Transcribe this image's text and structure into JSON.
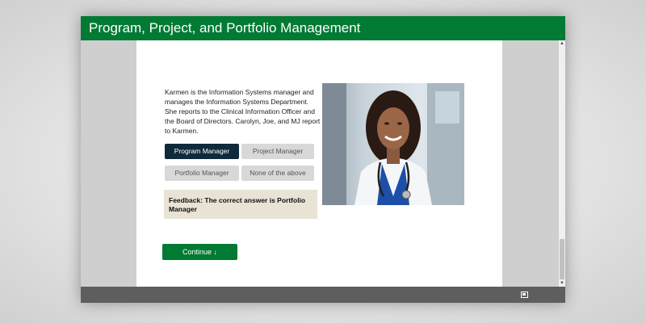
{
  "window": {
    "title": "Program, Project, and Portfolio Management"
  },
  "question": {
    "text": "Karmen is the Information Systems manager and manages the Information Systems Department. She reports to the Clinical Information Officer and the Board of Directors. Carolyn, Joe, and MJ report to Karmen."
  },
  "options": [
    {
      "label": "Program Manager",
      "selected": true
    },
    {
      "label": "Project Manager",
      "selected": false
    },
    {
      "label": "Portfolio Manager",
      "selected": false
    },
    {
      "label": "None of the above",
      "selected": false
    }
  ],
  "feedback": {
    "text": "Feedback: The correct answer is Portfolio Manager"
  },
  "continue_button": {
    "label": "Continue ↓"
  },
  "colors": {
    "brand_green": "#017a33",
    "selected_option": "#0f2a3a",
    "option_bg": "#d8d8d8",
    "feedback_bg": "#e8e3d5",
    "bottombar": "#5e5e5e"
  },
  "icons": {
    "fullscreen": "fullscreen-icon",
    "scroll_up": "scroll-up-icon",
    "scroll_down": "scroll-down-icon"
  }
}
